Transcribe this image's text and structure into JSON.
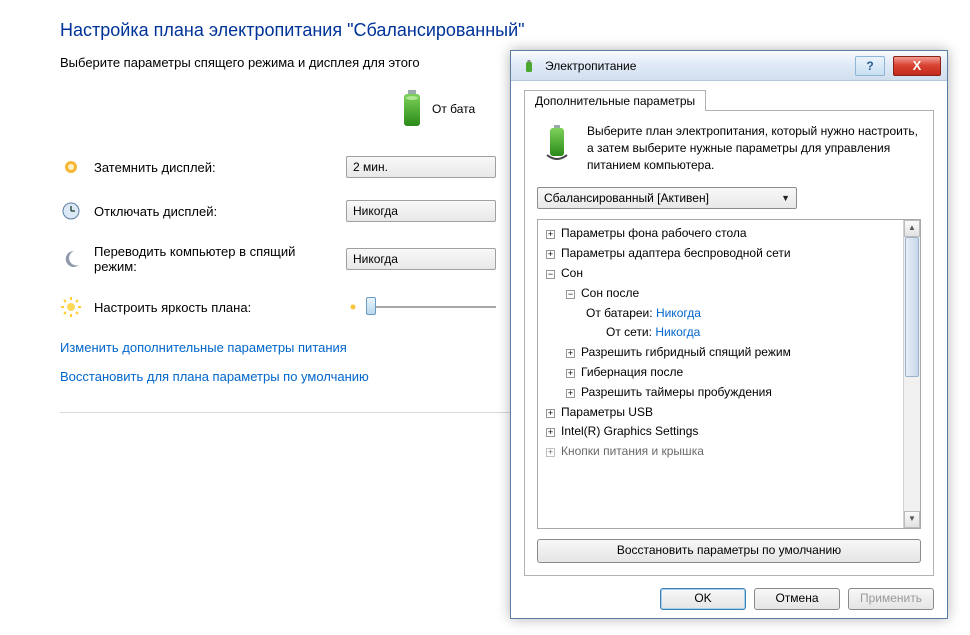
{
  "page": {
    "title": "Настройка плана электропитания \"Сбалансированный\"",
    "subtitle": "Выберите параметры спящего режима и дисплея для этого",
    "battery_header": "От бата"
  },
  "settings": {
    "dim": {
      "label": "Затемнить дисплей:",
      "value": "2 мин."
    },
    "off": {
      "label": "Отключать дисплей:",
      "value": "Никогда"
    },
    "sleep": {
      "label": "Переводить компьютер в спящий режим:",
      "value": "Никогда"
    },
    "brightness": {
      "label": "Настроить яркость плана:"
    }
  },
  "links": {
    "advanced": "Изменить дополнительные параметры питания",
    "restore": "Восстановить для плана параметры по умолчанию"
  },
  "dialog": {
    "title": "Электропитание",
    "tab": "Дополнительные параметры",
    "intro": "Выберите план электропитания, который нужно настроить, а затем выберите нужные параметры для управления питанием компьютера.",
    "dropdown": "Сбалансированный [Активен]",
    "tree": {
      "bg": "Параметры фона рабочего стола",
      "adapter": "Параметры адаптера беспроводной сети",
      "sleep": "Сон",
      "sleep_after": "Сон после",
      "on_battery": "От батареи:",
      "on_battery_val": "Никогда",
      "on_ac": "От сети:",
      "on_ac_val": "Никогда",
      "hybrid": "Разрешить гибридный спящий режим",
      "hibernate": "Гибернация после",
      "wake_timers": "Разрешить таймеры пробуждения",
      "usb": "Параметры USB",
      "intel": "Intel(R) Graphics Settings",
      "buttons": "Кнопки питания и крышка"
    },
    "restore_btn": "Восстановить параметры по умолчанию",
    "ok": "OK",
    "cancel": "Отмена",
    "apply": "Применить"
  }
}
